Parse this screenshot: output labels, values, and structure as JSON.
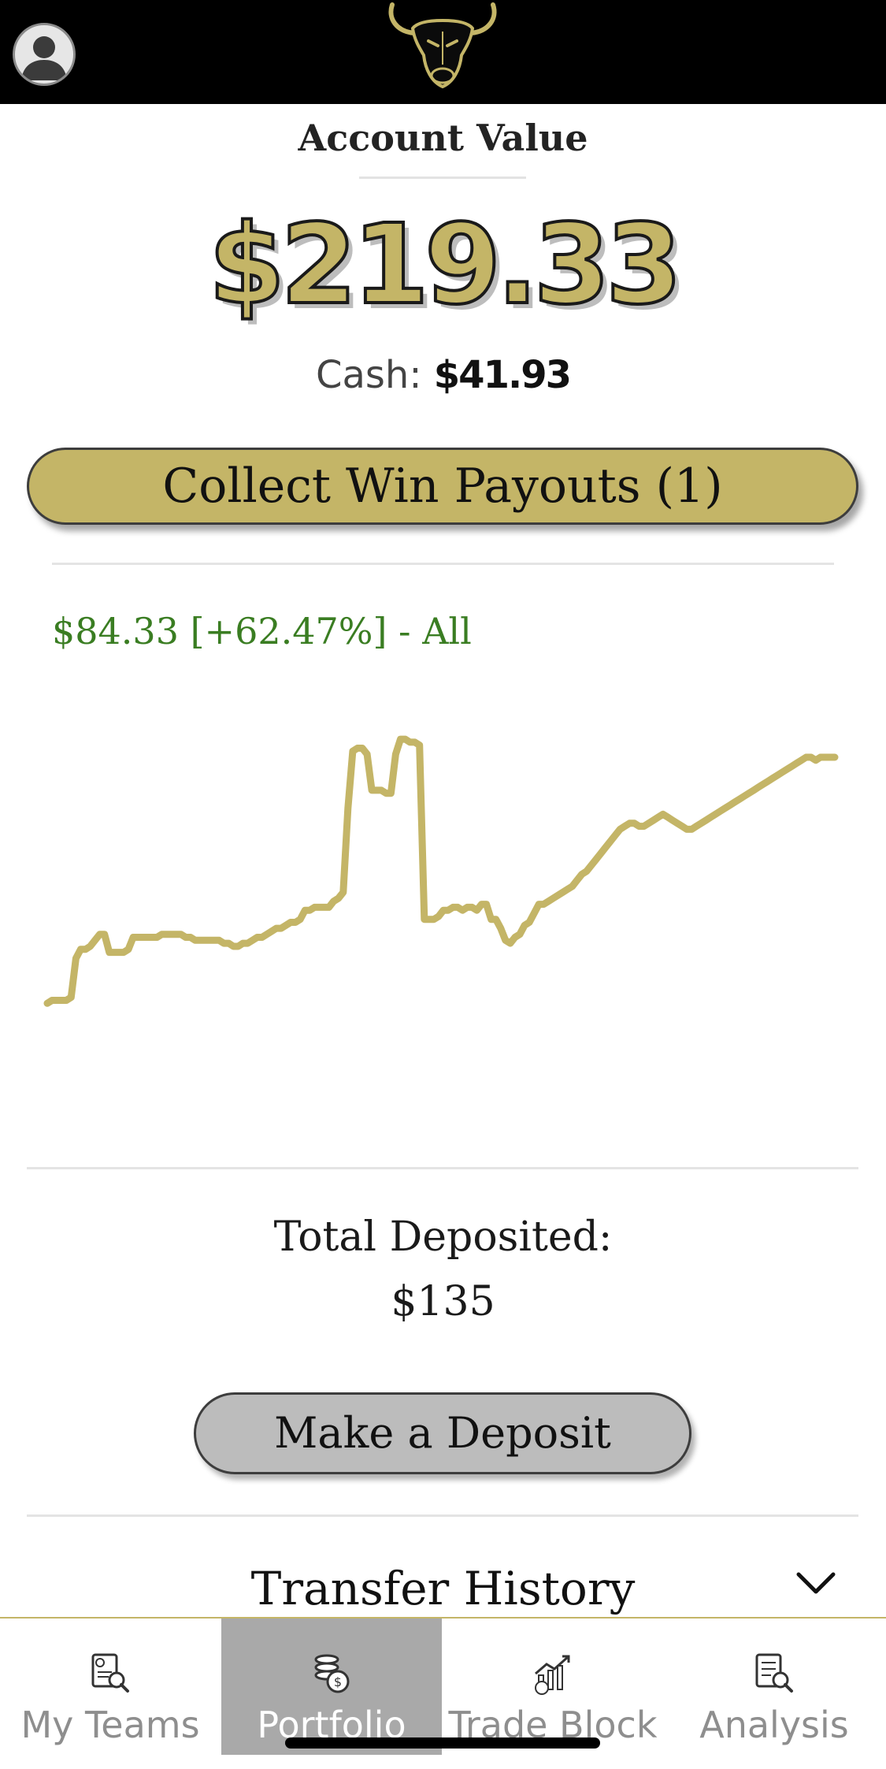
{
  "header": {
    "avatar_icon": "user-avatar-icon",
    "logo_icon": "bull-logo-icon"
  },
  "account": {
    "title": "Account Value",
    "value": "$219.33",
    "cash_label": "Cash:",
    "cash_value": "$41.93"
  },
  "collect_button": "Collect Win Payouts (1)",
  "performance": {
    "summary": "$84.33 [+62.47%] - All"
  },
  "chart_data": {
    "type": "line",
    "title": "",
    "xlabel": "",
    "ylabel": "",
    "color": "#c4b567",
    "axes_visible": false,
    "grid": false,
    "ylim": [
      130,
      235
    ],
    "x": [
      0,
      1,
      2,
      3,
      4,
      5,
      6,
      7,
      8,
      9,
      10,
      11,
      12,
      13,
      14,
      15,
      16,
      17,
      18,
      19,
      20,
      21,
      22,
      23,
      24,
      25,
      26,
      27,
      28,
      29,
      30,
      31,
      32,
      33,
      34,
      35,
      36,
      37,
      38,
      39,
      40,
      41,
      42,
      43,
      44,
      45,
      46,
      47,
      48,
      49,
      50,
      51,
      52,
      53,
      54,
      55,
      56,
      57,
      58,
      59,
      60,
      61,
      62,
      63,
      64,
      65,
      66,
      67,
      68,
      69,
      70,
      71,
      72,
      73,
      74,
      75,
      76,
      77,
      78,
      79,
      80,
      81,
      82,
      83,
      84,
      85,
      86,
      87,
      88,
      89,
      90,
      91,
      92,
      93,
      94,
      95,
      96,
      97,
      98,
      99,
      100,
      101,
      102,
      103,
      104,
      105,
      106,
      107,
      108,
      109,
      110,
      111,
      112,
      113,
      114,
      115,
      116,
      117,
      118,
      119,
      120,
      121,
      122,
      123,
      124,
      125,
      126,
      127,
      128,
      129,
      130,
      131,
      132,
      133,
      134,
      135,
      136,
      137,
      138,
      139,
      140,
      141,
      142,
      143,
      144,
      145,
      146,
      147,
      148,
      149,
      150,
      151,
      152,
      153,
      154,
      155,
      156,
      157,
      158,
      159,
      160,
      161,
      162,
      163,
      164,
      165
    ],
    "values": [
      137,
      138,
      138,
      138,
      138,
      139,
      152,
      155,
      155,
      156,
      158,
      160,
      160,
      154,
      154,
      154,
      154,
      155,
      159,
      159,
      159,
      159,
      159,
      159,
      160,
      160,
      160,
      160,
      160,
      159,
      159,
      158,
      158,
      158,
      158,
      158,
      158,
      157,
      157,
      156,
      156,
      157,
      157,
      158,
      159,
      159,
      160,
      161,
      162,
      162,
      163,
      164,
      164,
      165,
      168,
      168,
      169,
      169,
      169,
      169,
      171,
      172,
      174,
      202,
      221,
      222,
      222,
      220,
      208,
      208,
      208,
      207,
      207,
      220,
      225,
      225,
      224,
      224,
      223,
      165,
      165,
      165,
      166,
      168,
      168,
      169,
      169,
      168,
      169,
      169,
      168,
      170,
      170,
      165,
      165,
      162,
      158,
      157,
      159,
      160,
      163,
      164,
      167,
      170,
      170,
      171,
      172,
      173,
      174,
      175,
      176,
      178,
      180,
      181,
      183,
      185,
      187,
      189,
      191,
      193,
      195,
      196,
      197,
      197,
      196,
      196,
      197,
      198,
      199,
      200,
      199,
      198,
      197,
      196,
      195,
      195,
      196,
      197,
      198,
      199,
      200,
      201,
      202,
      203,
      204,
      205,
      206,
      207,
      208,
      209,
      210,
      211,
      212,
      213,
      214,
      215,
      216,
      217,
      218,
      219,
      219,
      218,
      219,
      219,
      219,
      219
    ]
  },
  "deposit": {
    "total_label": "Total Deposited:",
    "total_value": "$135",
    "button": "Make a Deposit"
  },
  "transfer_history": {
    "label": "Transfer History",
    "toggle_icon": "chevron-down-icon"
  },
  "tabs": [
    {
      "label": "My Teams",
      "icon": "team-report-icon",
      "active": false
    },
    {
      "label": "Portfolio",
      "icon": "coins-icon",
      "active": true
    },
    {
      "label": "Trade Block",
      "icon": "growth-chart-icon",
      "active": false
    },
    {
      "label": "Analysis",
      "icon": "analysis-report-icon",
      "active": false
    }
  ]
}
